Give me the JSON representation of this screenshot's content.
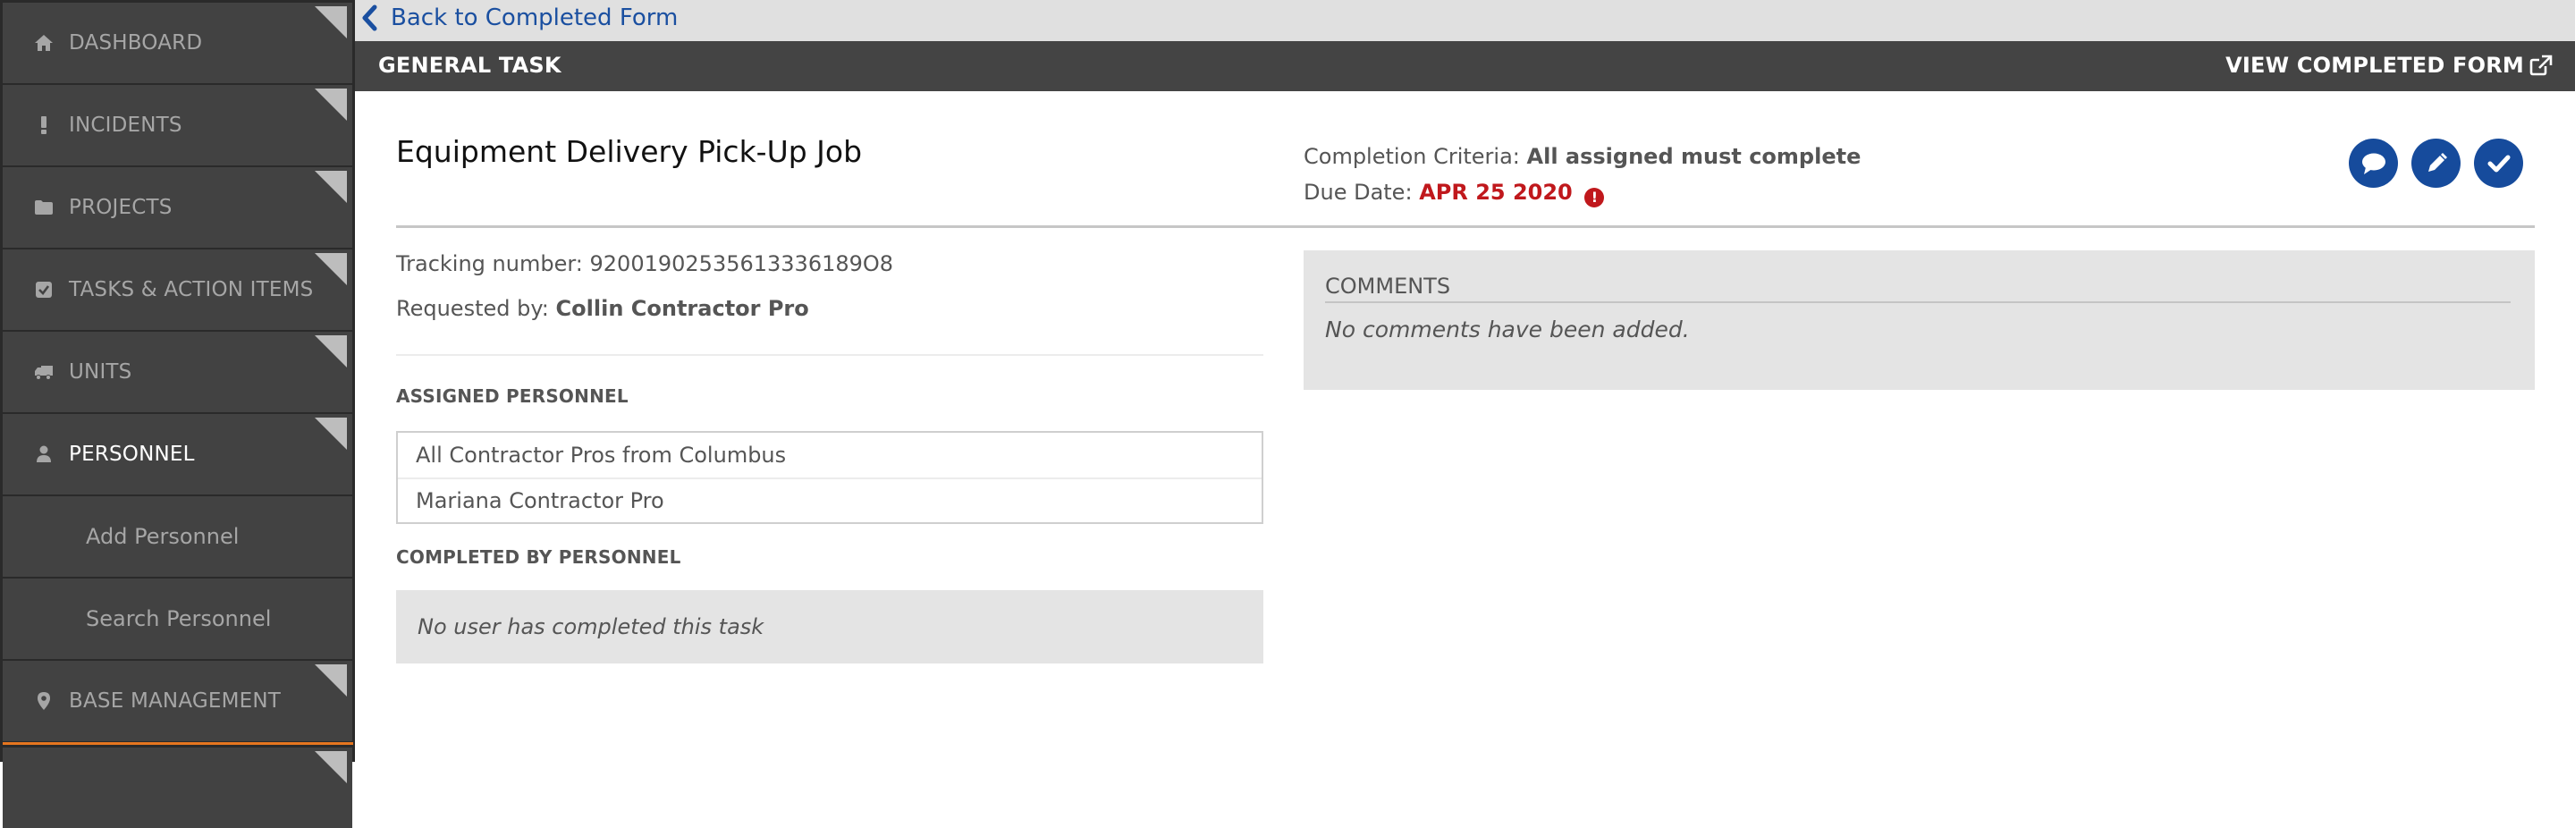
{
  "sidebar": {
    "items": [
      {
        "label": "DASHBOARD",
        "icon": "home-icon"
      },
      {
        "label": "INCIDENTS",
        "icon": "exclamation-icon"
      },
      {
        "label": "PROJECTS",
        "icon": "folder-icon"
      },
      {
        "label": "TASKS & ACTION ITEMS",
        "icon": "checkbox-icon"
      },
      {
        "label": "UNITS",
        "icon": "truck-icon"
      },
      {
        "label": "PERSONNEL",
        "icon": "user-icon",
        "active": true
      },
      {
        "label": "Add Personnel",
        "sub": true
      },
      {
        "label": "Search Personnel",
        "sub": true
      },
      {
        "label": "BASE MANAGEMENT",
        "icon": "map-marker-icon"
      }
    ]
  },
  "nav": {
    "back_label": "Back to Completed Form"
  },
  "header": {
    "title": "GENERAL TASK",
    "view_form_label": "VIEW COMPLETED FORM"
  },
  "task": {
    "title": "Equipment Delivery Pick-Up Job",
    "completion_criteria_label": "Completion Criteria:",
    "completion_criteria_value": "All assigned must complete",
    "due_date_label": "Due Date:",
    "due_date_value": "APR 25 2020",
    "overdue_icon": "!",
    "tracking_label": "Tracking number:",
    "tracking_value": "92001902535613336189O8",
    "requested_label": "Requested by:",
    "requested_value": "Collin Contractor Pro"
  },
  "actions": {
    "comment": "comment-icon",
    "edit": "pencil-icon",
    "complete": "check-icon"
  },
  "assigned": {
    "heading": "ASSIGNED PERSONNEL",
    "rows": [
      "All Contractor Pros from Columbus",
      "Mariana Contractor Pro"
    ]
  },
  "completed": {
    "heading": "COMPLETED BY PERSONNEL",
    "empty_text": "No user has completed this task"
  },
  "comments": {
    "heading": "COMMENTS",
    "empty_text": "No comments have been added."
  },
  "colors": {
    "accent_blue": "#164b9c",
    "link_blue": "#1a4fa0",
    "overdue_red": "#c0181c",
    "sidebar_bg": "#424242",
    "header_bg": "#444444",
    "active_marker": "#e6761f"
  }
}
